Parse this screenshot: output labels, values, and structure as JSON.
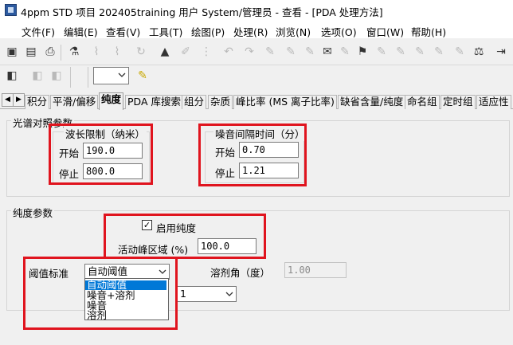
{
  "window": {
    "title": "4ppm STD 项目 202405training 用户 System/管理员 - 查看 - [PDA 处理方法]"
  },
  "menu": [
    "文件(F)",
    "编辑(E)",
    "查看(V)",
    "工具(T)",
    "绘图(P)",
    "处理(R)",
    "浏览(N)",
    "选项(O)",
    "窗口(W)",
    "帮助(H)"
  ],
  "toolbar": {
    "icons": [
      "save-icon",
      "open-icon",
      "print-icon",
      "process-icon",
      "integrate-icon",
      "peak-icon",
      "refresh-icon",
      "chart-icon",
      "spectrum-icon",
      "ruler-icon",
      "undo-icon",
      "redo-icon",
      "tool-icon",
      "tool2-icon",
      "tool3-icon",
      "tool4-icon",
      "tool5-icon",
      "tool6-icon",
      "tool7-icon",
      "tool8-icon",
      "tool9-icon",
      "tool10-icon",
      "tool11-icon",
      "tool12-icon",
      "exit-icon"
    ],
    "combo_value": ""
  },
  "tabs": [
    "积分",
    "平滑/偏移",
    "纯度",
    "PDA 库搜索",
    "组分",
    "杂质",
    "峰比率 (MS 离子比率)",
    "缺省含量/纯度",
    "命名组",
    "定时组",
    "适应性"
  ],
  "spectral": {
    "group_label": "光谱对照参数",
    "wavelength": {
      "title": "波长限制（纳米）",
      "start_label": "开始",
      "start_value": "190.0",
      "stop_label": "停止",
      "stop_value": "800.0"
    },
    "noise": {
      "title": "噪音间隔时间（分）",
      "start_label": "开始",
      "start_value": "0.70",
      "stop_label": "停止",
      "stop_value": "1.21"
    }
  },
  "purity": {
    "group_label": "纯度参数",
    "enable_label": "启用纯度",
    "enable_checked": "✓",
    "active_region_label": "活动峰区域 (%)",
    "active_region_value": "100.0",
    "threshold_label": "阈值标准",
    "threshold_value": "自动阈值",
    "threshold_options": [
      "自动阈值",
      "噪音+溶剂",
      "噪音",
      "溶剂"
    ],
    "solvent_angle_label": "溶剂角（度）",
    "solvent_angle_value": "1.00",
    "second_combo_value": "1"
  }
}
